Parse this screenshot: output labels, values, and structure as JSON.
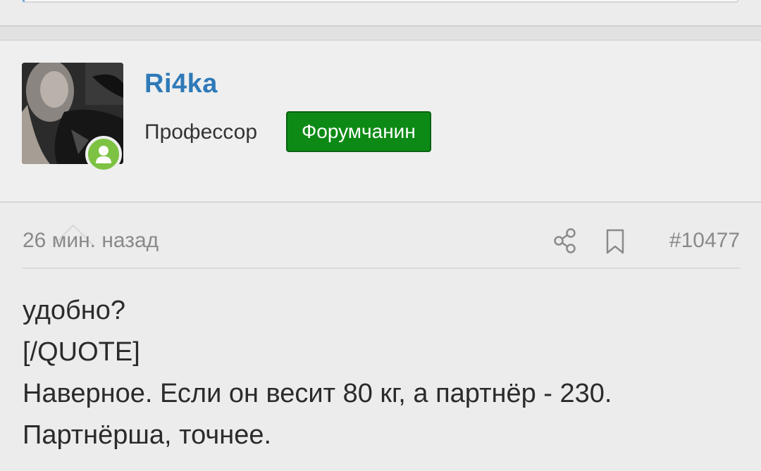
{
  "user": {
    "name": "Ri4ka",
    "title": "Профессор",
    "role_badge": "Форумчанин",
    "online": true
  },
  "post": {
    "time": "26 мин. назад",
    "number": "#10477",
    "lines": [
      "удобно?",
      "[/QUOTE]",
      "Наверное. Если он весит 80 кг, а партнёр - 230.",
      "Партнёрша, точнее."
    ]
  },
  "icons": {
    "share": "share-icon",
    "bookmark": "bookmark-icon",
    "online": "user-online-icon"
  },
  "colors": {
    "username": "#2f7ab8",
    "role_badge_bg": "#0d8a16",
    "online_badge": "#7dc242",
    "background": "#ececec"
  }
}
